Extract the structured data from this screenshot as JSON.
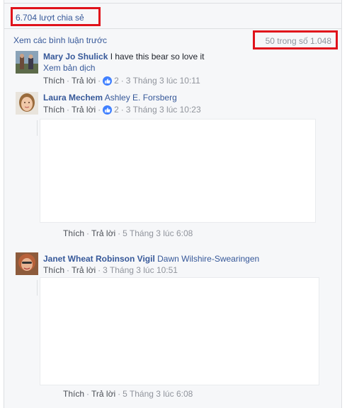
{
  "shares": {
    "label": "6.704 lượt chia sẻ"
  },
  "comments_header": {
    "view_previous": "Xem các bình luận trước",
    "count": "50 trong số 1.048"
  },
  "comments": [
    {
      "author": "Mary Jo Shulick",
      "text": "I have this bear so love it",
      "translate": "Xem bản dịch",
      "like": "Thích",
      "reply": "Trả lời",
      "reactions": "2",
      "time": "3 Tháng 3 lúc 10:11"
    },
    {
      "author": "Laura Mechem",
      "text": "Ashley E. Forsberg",
      "like": "Thích",
      "reply": "Trả lời",
      "reactions": "2",
      "time": "3 Tháng 3 lúc 10:23",
      "reply_meta": {
        "like": "Thích",
        "reply": "Trả lời",
        "time": "5 Tháng 3 lúc 6:08"
      }
    },
    {
      "author": "Janet Wheat Robinson Vigil",
      "text": "Dawn Wilshire-Swearingen",
      "like": "Thích",
      "reply": "Trả lời",
      "time": "3 Tháng 3 lúc 10:51",
      "reply_meta": {
        "like": "Thích",
        "reply": "Trả lời",
        "time": "5 Tháng 3 lúc 6:08"
      }
    }
  ],
  "colors": {
    "link_blue": "#365899",
    "highlight_red": "#e0121b",
    "meta_gray": "#90949c",
    "like_blue": "#4080ff"
  }
}
